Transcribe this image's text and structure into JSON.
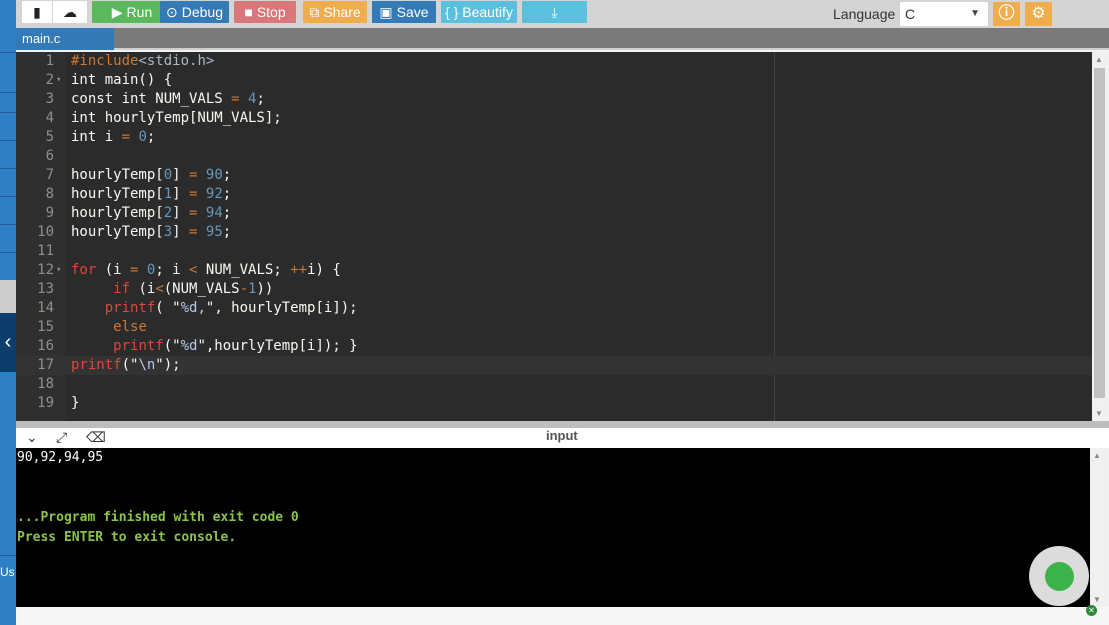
{
  "toolbar": {
    "run": "Run",
    "debug": "Debug",
    "stop": "Stop",
    "share": "Share",
    "save": "Save",
    "beautify": "{ } Beautify",
    "language_label": "Language",
    "language_value": "C",
    "colors": {
      "run": "#5cb85c",
      "debug": "#337ab7",
      "stop": "#d9534f",
      "share": "#f0ad4e",
      "save": "#337ab7",
      "beautify": "#5bc0de",
      "download": "#5bc0de"
    }
  },
  "tabs": [
    {
      "label": "main.c"
    }
  ],
  "code": [
    [
      [
        "#include",
        "pp"
      ],
      [
        "<stdio.h>",
        "inc"
      ]
    ],
    [
      [
        "int main() {",
        "kw"
      ]
    ],
    [
      [
        "const int NUM_VALS ",
        "kw"
      ],
      [
        "=",
        "op"
      ],
      [
        " ",
        "kw"
      ],
      [
        "4",
        "num"
      ],
      [
        ";",
        "kw"
      ]
    ],
    [
      [
        "int hourlyTemp[NUM_VALS];",
        "kw"
      ]
    ],
    [
      [
        "int i ",
        "kw"
      ],
      [
        "=",
        "op"
      ],
      [
        " ",
        "kw"
      ],
      [
        "0",
        "num"
      ],
      [
        ";",
        "kw"
      ]
    ],
    [],
    [
      [
        "hourlyTemp[",
        "kw"
      ],
      [
        "0",
        "num"
      ],
      [
        "] ",
        "kw"
      ],
      [
        "=",
        "op"
      ],
      [
        " ",
        "kw"
      ],
      [
        "90",
        "num"
      ],
      [
        ";",
        "kw"
      ]
    ],
    [
      [
        "hourlyTemp[",
        "kw"
      ],
      [
        "1",
        "num"
      ],
      [
        "] ",
        "kw"
      ],
      [
        "=",
        "op"
      ],
      [
        " ",
        "kw"
      ],
      [
        "92",
        "num"
      ],
      [
        ";",
        "kw"
      ]
    ],
    [
      [
        "hourlyTemp[",
        "kw"
      ],
      [
        "2",
        "num"
      ],
      [
        "] ",
        "kw"
      ],
      [
        "=",
        "op"
      ],
      [
        " ",
        "kw"
      ],
      [
        "94",
        "num"
      ],
      [
        ";",
        "kw"
      ]
    ],
    [
      [
        "hourlyTemp[",
        "kw"
      ],
      [
        "3",
        "num"
      ],
      [
        "] ",
        "kw"
      ],
      [
        "=",
        "op"
      ],
      [
        " ",
        "kw"
      ],
      [
        "95",
        "num"
      ],
      [
        ";",
        "kw"
      ]
    ],
    [],
    [
      [
        "for",
        "red"
      ],
      [
        " (i ",
        "kw"
      ],
      [
        "=",
        "op"
      ],
      [
        " ",
        "kw"
      ],
      [
        "0",
        "num"
      ],
      [
        "; i ",
        "kw"
      ],
      [
        "<",
        "op"
      ],
      [
        " NUM_VALS; ",
        "kw"
      ],
      [
        "++",
        "op"
      ],
      [
        "i) {",
        "kw"
      ]
    ],
    [
      [
        "     ",
        "kw"
      ],
      [
        "if",
        "red"
      ],
      [
        " (i",
        "kw"
      ],
      [
        "<",
        "op"
      ],
      [
        "(NUM_VALS",
        "kw"
      ],
      [
        "-",
        "op"
      ],
      [
        "1",
        "num"
      ],
      [
        "))",
        "kw"
      ]
    ],
    [
      [
        "    ",
        "kw"
      ],
      [
        "printf",
        "red"
      ],
      [
        "( \"",
        "kw"
      ],
      [
        "%d,",
        "s"
      ],
      [
        "\", hourlyTemp[i]);",
        "kw"
      ]
    ],
    [
      [
        "     ",
        "kw"
      ],
      [
        "else",
        "orange-kw"
      ]
    ],
    [
      [
        "     ",
        "kw"
      ],
      [
        "printf",
        "red"
      ],
      [
        "(\"",
        "kw"
      ],
      [
        "%d",
        "s"
      ],
      [
        "\",hourlyTemp[i]); }",
        "kw"
      ]
    ],
    [
      [
        "printf",
        "red"
      ],
      [
        "(\"",
        "kw"
      ],
      [
        "\\n",
        "s"
      ],
      [
        "\");",
        "kw"
      ]
    ],
    [],
    [
      [
        "}",
        "kw"
      ]
    ]
  ],
  "console": {
    "header_label": "input",
    "output": "90,92,94,95",
    "finished": "...Program finished with exit code 0",
    "press": "Press ENTER to exit console.",
    "text_color": "#ffffff",
    "status_color": "#8bc34a"
  },
  "sidebar": {
    "bottom_text": "Us"
  }
}
